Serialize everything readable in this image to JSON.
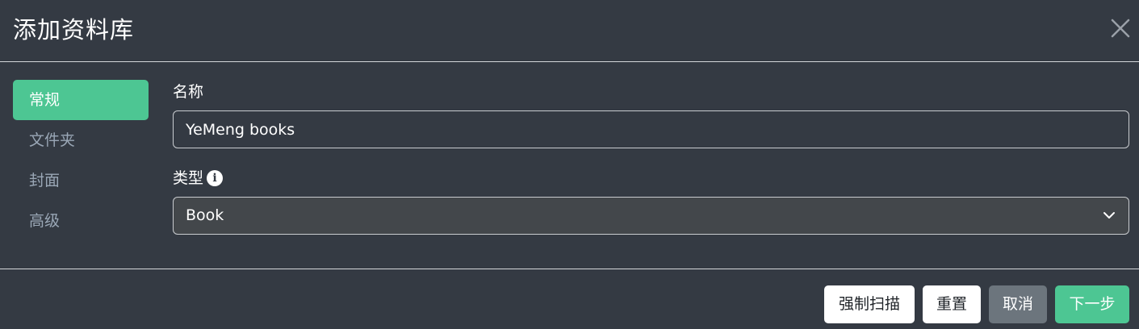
{
  "dialog": {
    "title": "添加资料库",
    "close_icon": "close-icon"
  },
  "nav": {
    "items": [
      {
        "label": "常规",
        "active": true
      },
      {
        "label": "文件夹",
        "active": false
      },
      {
        "label": "封面",
        "active": false
      },
      {
        "label": "高级",
        "active": false
      }
    ]
  },
  "form": {
    "name": {
      "label": "名称",
      "value": "YeMeng books"
    },
    "type": {
      "label": "类型",
      "info_icon": "info-icon",
      "selected": "Book"
    }
  },
  "footer": {
    "force_scan_label": "强制扫描",
    "reset_label": "重置",
    "cancel_label": "取消",
    "next_label": "下一步"
  },
  "colors": {
    "background": "#343a43",
    "accent": "#4dc693",
    "nav_inactive": "#9aa7b6",
    "cancel_button": "#6c757d"
  }
}
